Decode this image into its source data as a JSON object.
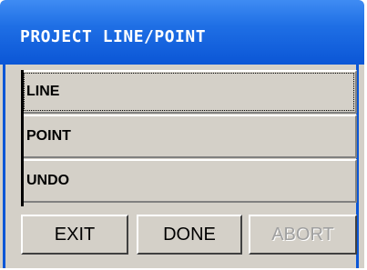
{
  "window": {
    "title": "PROJECT LINE/POINT"
  },
  "menu": {
    "items": [
      {
        "label": "LINE"
      },
      {
        "label": "POINT"
      },
      {
        "label": "UNDO"
      }
    ]
  },
  "actions": {
    "exit_label": "EXIT",
    "done_label": "DONE",
    "abort_label": "ABORT"
  },
  "colors": {
    "titlebar": "#0b56d6",
    "panel": "#d4d0c8",
    "disabled_text": "#a0a0a0"
  }
}
